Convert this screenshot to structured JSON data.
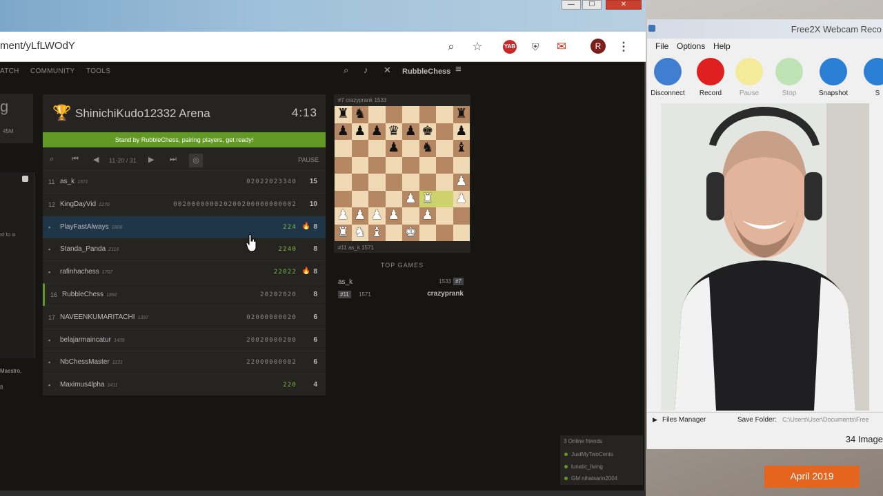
{
  "browser": {
    "url": "ment/yLfLWOdY",
    "window_close": "✕",
    "window_min": "—",
    "window_max": "☐",
    "avatar_letter": "R",
    "ext_yab": "YAB"
  },
  "nav": {
    "items": [
      "ATCH",
      "COMMUNITY",
      "TOOLS"
    ],
    "username": "RubbleChess"
  },
  "side": {
    "title": "g",
    "small1": "45M",
    "text1": "st to a",
    "text2": "Maestro,",
    "text3": "8"
  },
  "tournament": {
    "name": "ShinichiKudo12332 Arena",
    "clock": "4:13",
    "standby": "Stand by RubbleChess, pairing players, get ready!",
    "page_info": "11-20 / 31",
    "pause": "PAUSE",
    "rows": [
      {
        "rank": "11",
        "name": "as_k",
        "rating": "1571",
        "scores": "02022023340",
        "green": false,
        "total": "15",
        "fire": false,
        "me": false,
        "hl": false
      },
      {
        "rank": "12",
        "name": "KingDayVid",
        "rating": "1270",
        "scores": "002000000020200200000000002",
        "green": false,
        "total": "10",
        "fire": false,
        "me": false,
        "hl": false
      },
      {
        "rank": "",
        "name": "PlayFastAlways",
        "rating": "1808",
        "scores": "224",
        "green": true,
        "total": "8",
        "fire": true,
        "me": false,
        "hl": true
      },
      {
        "rank": "",
        "name": "Standa_Panda",
        "rating": "2116",
        "scores": "2240",
        "green": true,
        "total": "8",
        "fire": false,
        "me": false,
        "hl": false
      },
      {
        "rank": "",
        "name": "rafinhachess",
        "rating": "1707",
        "scores": "22022",
        "green": true,
        "total": "8",
        "fire": true,
        "me": false,
        "hl": false
      },
      {
        "rank": "16",
        "name": "RubbleChess",
        "rating": "1892",
        "scores": "20202020",
        "green": false,
        "total": "8",
        "fire": false,
        "me": true,
        "hl": false
      },
      {
        "rank": "17",
        "name": "NAVEENKUMARITACHI",
        "rating": "1397",
        "scores": "02000000020",
        "green": false,
        "total": "6",
        "fire": false,
        "me": false,
        "hl": false
      },
      {
        "rank": "",
        "name": "belajarmaincatur",
        "rating": "1439",
        "scores": "20020000200",
        "green": false,
        "total": "6",
        "fire": false,
        "me": false,
        "hl": false
      },
      {
        "rank": "",
        "name": "NbChessMaster",
        "rating": "1131",
        "scores": "22000000002",
        "green": false,
        "total": "6",
        "fire": false,
        "me": false,
        "hl": false
      },
      {
        "rank": "",
        "name": "Maximus4lpha",
        "rating": "1411",
        "scores": "220",
        "green": true,
        "total": "4",
        "fire": false,
        "me": false,
        "hl": false
      }
    ]
  },
  "featured": {
    "top_label": "#7  crazyprank 1533",
    "bottom_label": "#11  as_k 1571",
    "board": [
      "r n . . . . . r",
      "p p p q p k . p",
      ". . . p . n . b",
      ". . . . . . . .",
      ". . . . . . . P",
      ". . . . P R . P",
      "P P P P . P . .",
      "R N B . K . . ."
    ],
    "highlight": [
      [
        5,
        5
      ],
      [
        5,
        6
      ]
    ]
  },
  "top_games": {
    "label": "TOP GAMES",
    "p1": "as_k",
    "r1": "1533",
    "b1": "#7",
    "b2": "#11",
    "r2": "1571",
    "p2": "crazyprank"
  },
  "friends": {
    "title": "3 Online friends",
    "list": [
      "JustMyTwoCents",
      "lunatic_living",
      "GM nihalsarin2004"
    ]
  },
  "webcam": {
    "title": "Free2X Webcam Reco",
    "menu": [
      "File",
      "Options",
      "Help"
    ],
    "tools": [
      {
        "label": "Disconnect",
        "color": "#3f7ed0",
        "disabled": false
      },
      {
        "label": "Record",
        "color": "#e02020",
        "disabled": false
      },
      {
        "label": "Pause",
        "color": "#f3ea9a",
        "disabled": true
      },
      {
        "label": "Stop",
        "color": "#bfe3b4",
        "disabled": true
      },
      {
        "label": "Snapshot",
        "color": "#2a7fd4",
        "disabled": false
      },
      {
        "label": "S",
        "color": "#2a7fd4",
        "disabled": false
      }
    ],
    "files_manager": "Files Manager",
    "save_folder": "Save Folder:",
    "save_path": "C:\\Users\\User\\Documents\\Free",
    "count": "34 Image"
  },
  "date": "April 2019"
}
